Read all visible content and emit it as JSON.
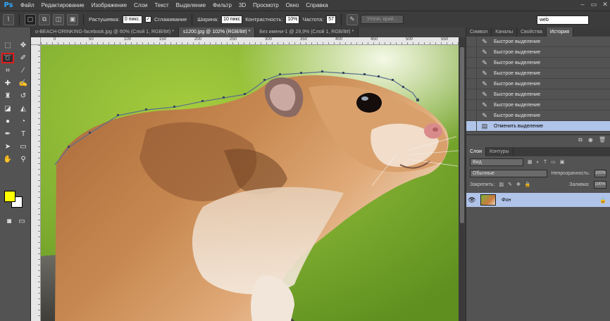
{
  "app": {
    "logo": "Ps"
  },
  "menu": [
    "Файл",
    "Редактирование",
    "Изображение",
    "Слои",
    "Текст",
    "Выделение",
    "Фильтр",
    "3D",
    "Просмотр",
    "Окно",
    "Справка"
  ],
  "window_controls": {
    "minimize": "–",
    "restore": "▭",
    "close": "✕"
  },
  "options": {
    "feather_label": "Растушевка:",
    "feather_value": "0 пикс.",
    "antialias_label": "Сглаживание",
    "antialias_checked": "✓",
    "width_label": "Ширина:",
    "width_value": "10 пикс",
    "contrast_label": "Контрастность:",
    "contrast_value": "10%",
    "frequency_label": "Частота:",
    "frequency_value": "57",
    "refine_edge_button": "Уточн. край...",
    "workspace": "web"
  },
  "doc_tabs": [
    "o-BEACH-DRINKING-facebook.jpg @ 60% (Слой 1, RGB/8#) *",
    "s1200.jpg @ 102% (RGB/8#) *",
    "Без имени-1 @ 29,9% (Слой 1, RGB/8#) *"
  ],
  "ruler_marks": [
    "0",
    "50",
    "100",
    "150",
    "200",
    "250",
    "300",
    "350",
    "400",
    "450",
    "500",
    "550"
  ],
  "history": {
    "tabs": [
      "Символ",
      "Каналы",
      "Свойства",
      "История"
    ],
    "items": [
      "Быстрое выделение",
      "Быстрое выделение",
      "Быстрое выделение",
      "Быстрое выделение",
      "Быстрое выделение",
      "Быстрое выделение",
      "Быстрое выделение",
      "Быстрое выделение",
      "Отменить выделение"
    ]
  },
  "layers": {
    "tabs": [
      "Слои",
      "Контуры"
    ],
    "filter_kind": "Вид",
    "blend_mode": "Обычные",
    "opacity_label": "Непрозрачность:",
    "opacity_value": "100%",
    "lock_label": "Закрепить:",
    "fill_label": "Заливка:",
    "fill_value": "100%",
    "layer_name": "Фон"
  },
  "colors": {
    "foreground": "#ffff00",
    "background": "#ffffff",
    "selected_tool_outline": "#e01c1c",
    "history_active": "#b0c3e8"
  }
}
